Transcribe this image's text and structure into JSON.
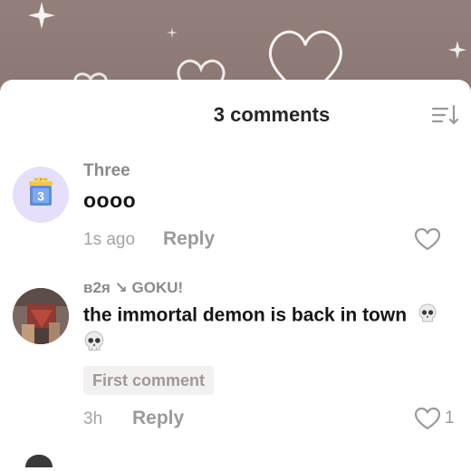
{
  "sheet": {
    "title": "3 comments",
    "sort_icon": "sort-descending-icon"
  },
  "comments": [
    {
      "username": "Three",
      "avatar_icon": "gift-box-3-avatar",
      "avatar_number": "3",
      "text": "oooo",
      "time": "1s ago",
      "reply_label": "Reply",
      "like_count": "",
      "like_icon": "heart-outline-icon"
    },
    {
      "username": "в2я ↘ GOKU!",
      "avatar_icon": "photo-avatar",
      "text": "the immortal demon is back in town",
      "emoji": "skull-emoji",
      "badge": "First comment",
      "time": "3h",
      "reply_label": "Reply",
      "like_count": "1",
      "like_icon": "heart-outline-icon"
    }
  ],
  "colors": {
    "backdrop": "#8c7873",
    "sheet": "#ffffff",
    "text_primary": "#161616",
    "text_secondary": "#8a8a8a",
    "avatar_bg": "#e6defb",
    "badge_bg": "#f3f0f0"
  }
}
